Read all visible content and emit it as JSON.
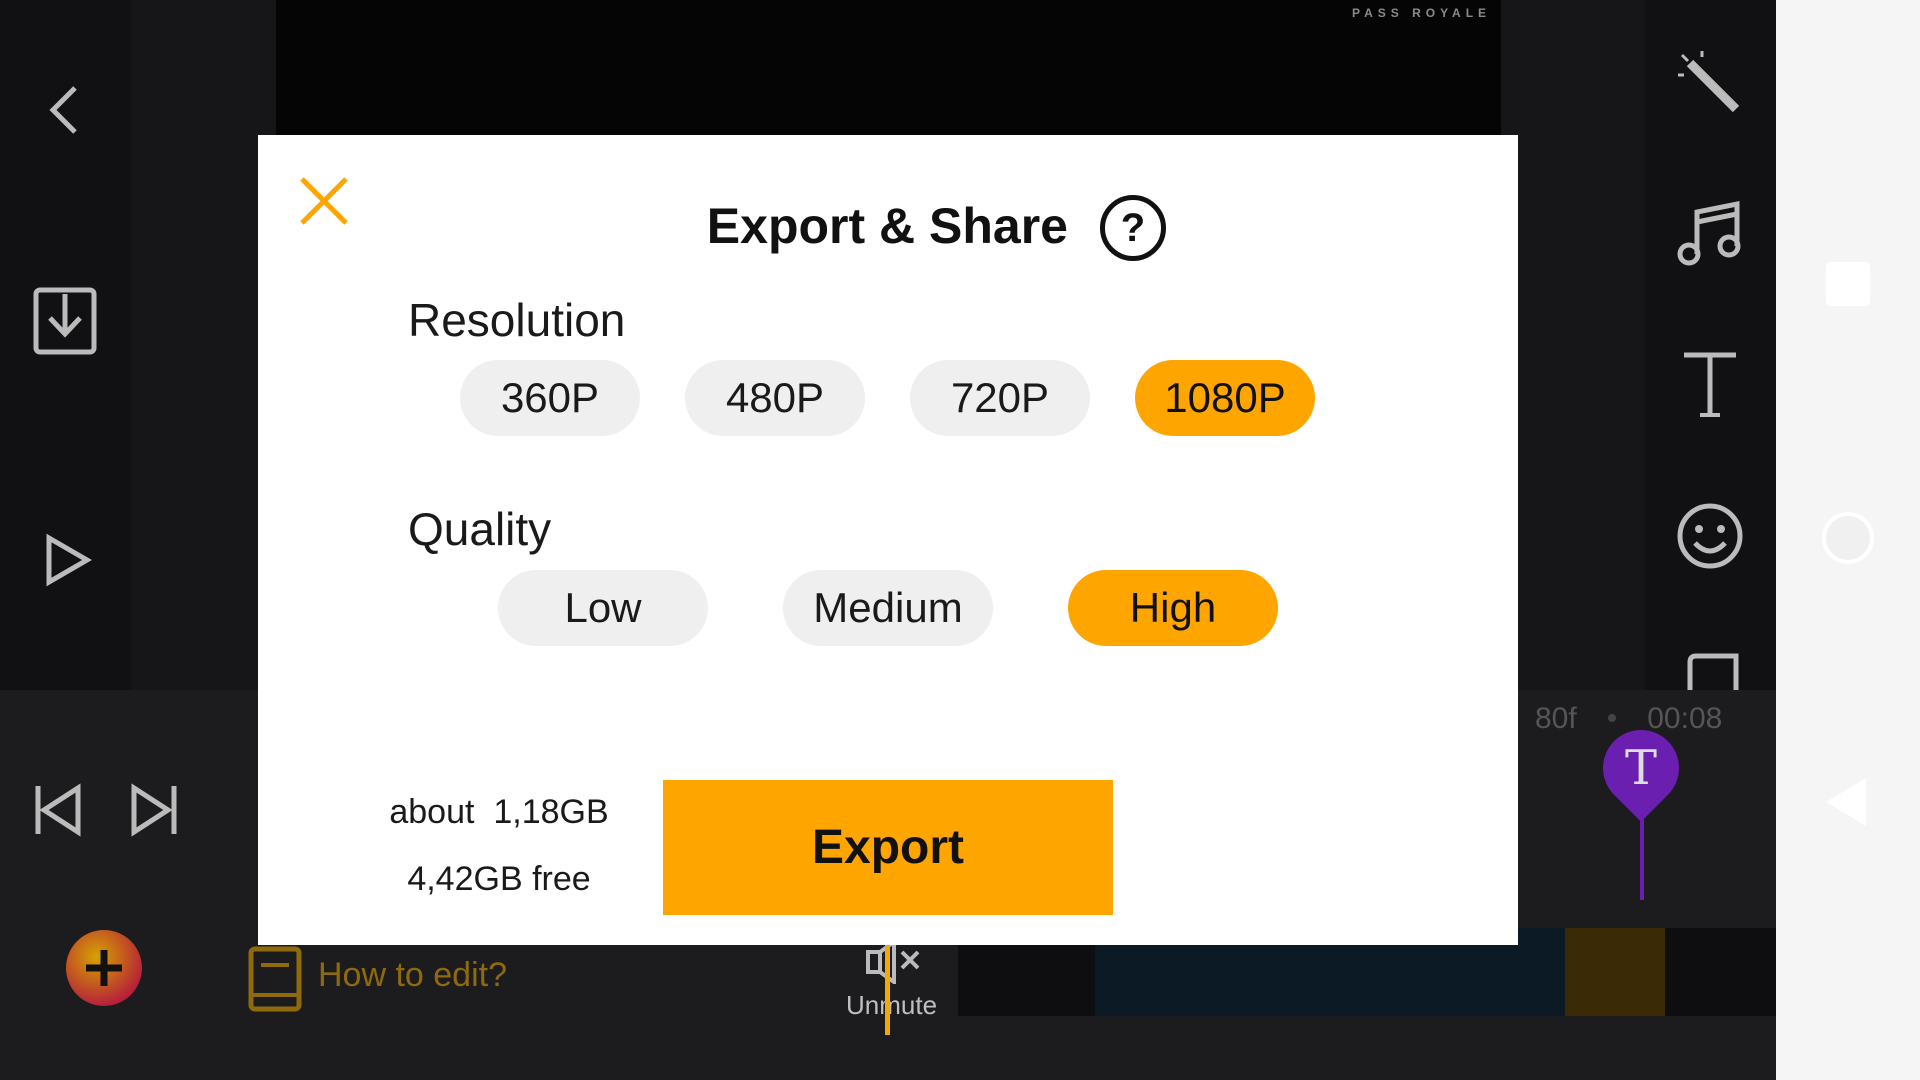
{
  "editor": {
    "watermark": "PASS ROYALE",
    "timecode_frames": "80f",
    "timecode_time": "00:08",
    "how_to_label": "How to edit?",
    "unmute_label": "Unmute",
    "text_marker_glyph": "T"
  },
  "dialog": {
    "title": "Export & Share",
    "help_glyph": "?",
    "resolution": {
      "label": "Resolution",
      "options": [
        "360P",
        "480P",
        "720P",
        "1080P"
      ],
      "selected": "1080P"
    },
    "quality": {
      "label": "Quality",
      "options": [
        "Low",
        "Medium",
        "High"
      ],
      "selected": "High"
    },
    "size_estimate": "about  1,18GB",
    "free_space": "4,42GB free",
    "export_label": "Export"
  },
  "colors": {
    "accent": "#ffa500",
    "dialog_bg": "#ffffff",
    "pill_bg": "#efefef",
    "marker": "#6a1fb0"
  },
  "icons": [
    "back-chevron-icon",
    "download-icon",
    "play-icon",
    "magic-wand-icon",
    "music-note-icon",
    "text-icon",
    "emoji-icon",
    "skip-start-icon",
    "skip-end-icon",
    "add-icon",
    "book-icon",
    "mute-speaker-icon",
    "close-icon",
    "help-icon"
  ]
}
